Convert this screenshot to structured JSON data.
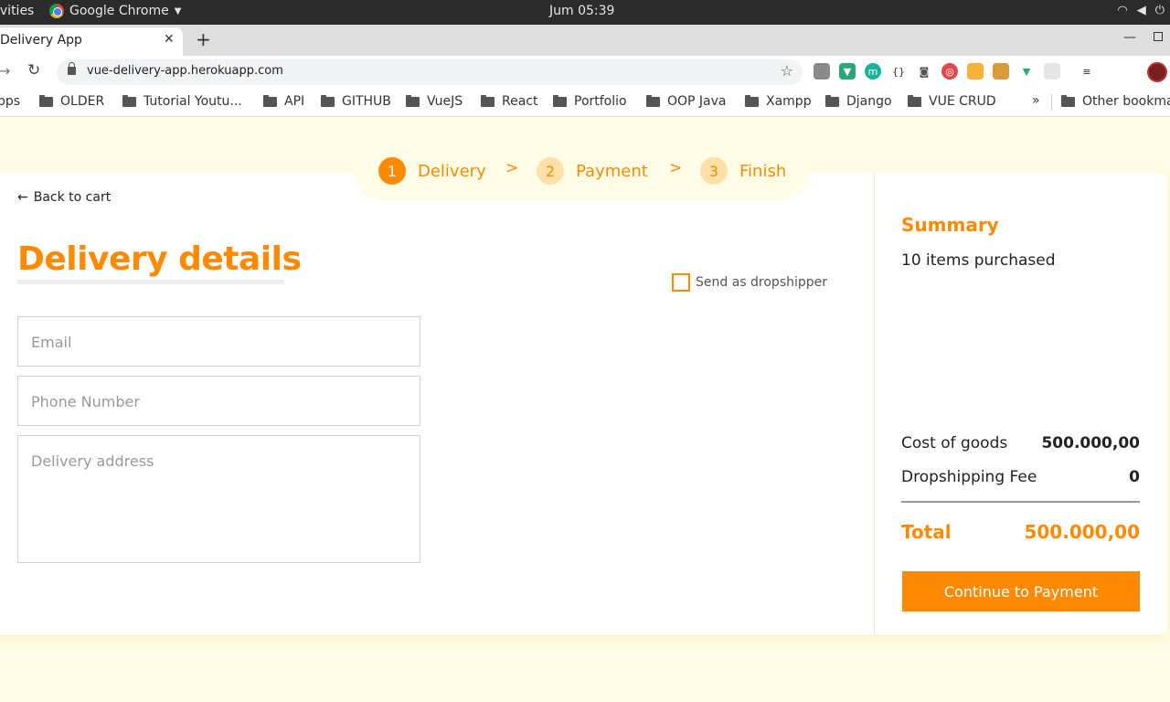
{
  "os": {
    "activities": "ivities",
    "app": "Google Chrome",
    "clock": "Jum 05:39"
  },
  "tab": {
    "title": "Delivery App",
    "close": "✕",
    "new_tab": "+"
  },
  "toolbar": {
    "url": "vue-delivery-app.herokuapp.com"
  },
  "bookmarks": {
    "apps": "pps",
    "items": [
      "OLDER",
      "Tutorial Youtu...",
      "API",
      "GITHUB",
      "VueJS",
      "React",
      "Portfolio",
      "OOP Java",
      "Xampp",
      "Django",
      "VUE CRUD"
    ],
    "more": "»",
    "other": "Other bookma"
  },
  "stepper": {
    "steps": [
      {
        "num": "1",
        "label": "Delivery"
      },
      {
        "num": "2",
        "label": "Payment"
      },
      {
        "num": "3",
        "label": "Finish"
      }
    ],
    "separator": ">"
  },
  "delivery": {
    "back": "Back to cart",
    "title": "Delivery details",
    "dropship_label": "Send as dropshipper",
    "email_placeholder": "Email",
    "phone_placeholder": "Phone Number",
    "address_placeholder": "Delivery address"
  },
  "summary": {
    "title": "Summary",
    "items": "10 items purchased",
    "cost_label": "Cost of goods",
    "cost_value": "500.000,00",
    "fee_label": "Dropshipping Fee",
    "fee_value": "0",
    "total_label": "Total",
    "total_value": "500.000,00",
    "button": "Continue to Payment"
  },
  "colors": {
    "accent": "#ff8a00",
    "page_bg": "#fffde6"
  }
}
